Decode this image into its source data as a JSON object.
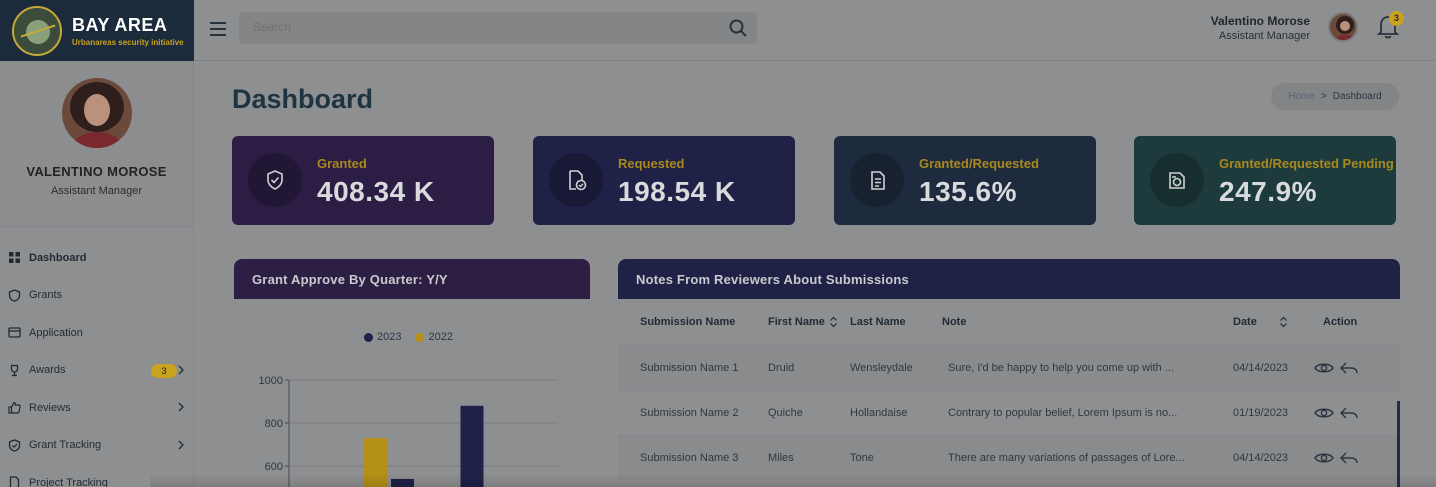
{
  "brand": {
    "title": "BAY AREA",
    "subtitle": "Urbanareas security initiative"
  },
  "header": {
    "search_placeholder": "Search",
    "user_name": "Valentino Morose",
    "user_role": "Assistant Manager",
    "notification_count": "3"
  },
  "profile": {
    "name": "VALENTINO MOROSE",
    "role": "Assistant Manager"
  },
  "sidebar": {
    "items": [
      {
        "label": "Dashboard",
        "icon": "grid-icon"
      },
      {
        "label": "Grants",
        "icon": "shield-icon"
      },
      {
        "label": "Application",
        "icon": "window-icon"
      },
      {
        "label": "Awards",
        "icon": "trophy-icon",
        "badge": "3"
      },
      {
        "label": "Reviews",
        "icon": "thumbs-up-icon"
      },
      {
        "label": "Grant Tracking",
        "icon": "shield-check-icon"
      },
      {
        "label": "Project Tracking",
        "icon": "document-icon"
      }
    ]
  },
  "page": {
    "title": "Dashboard"
  },
  "breadcrumb": {
    "home": "Home",
    "separator": ">",
    "current": "Dashboard"
  },
  "cards": [
    {
      "label": "Granted",
      "value": "408.34 K",
      "color": "#2c1d44"
    },
    {
      "label": "Requested",
      "value": "198.54 K",
      "color": "#1f2146"
    },
    {
      "label": "Granted/Requested",
      "value": "135.6%",
      "color": "#1e2b3e"
    },
    {
      "label": "Granted/Requested Pending",
      "value": "247.9%",
      "color": "#1d3b3c"
    }
  ],
  "chart_panel": {
    "title": "Grant Approve By Quarter: Y/Y",
    "header_color": "#2d1f43"
  },
  "chart_data": {
    "type": "bar",
    "title": "Grant Approve By Quarter: Y/Y",
    "series": [
      {
        "name": "2023",
        "color": "#1f2148",
        "values": [
          540,
          880
        ]
      },
      {
        "name": "2022",
        "color": "#b39016",
        "values": [
          730,
          null
        ]
      }
    ],
    "y_ticks": [
      1000,
      800,
      600
    ],
    "ylim": [
      0,
      1000
    ],
    "grid": true,
    "legend_position": "top-center"
  },
  "notes_panel": {
    "title": "Notes From Reviewers About Submissions",
    "header_color": "#1f2146",
    "columns": [
      "Submission Name",
      "First Name",
      "Last Name",
      "Note",
      "Date",
      "Action"
    ],
    "rows": [
      {
        "submission": "Submission Name 1",
        "first": "Druid",
        "last": "Wensleydale",
        "note": "Sure, I'd be happy to help you come up with ...",
        "date": "04/14/2023"
      },
      {
        "submission": "Submission Name 2",
        "first": "Quiche",
        "last": "Hollandaise",
        "note": "Contrary to popular belief, Lorem Ipsum is no...",
        "date": "01/19/2023"
      },
      {
        "submission": "Submission Name 3",
        "first": "Miles",
        "last": "Tone",
        "note": "There are many variations of passages of Lore...",
        "date": "04/14/2023"
      }
    ]
  }
}
